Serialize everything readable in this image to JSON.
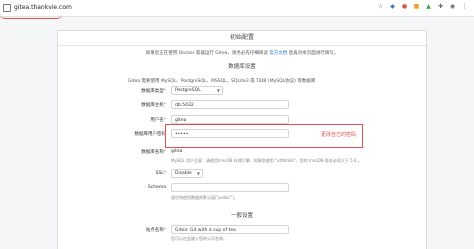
{
  "browser": {
    "url": "gitea.thankvie.com"
  },
  "page": {
    "title": "初始配置",
    "intro_text": "如果您正在使用 Docker 容器运行 Gitea，请务必先仔细阅读",
    "intro_link": "官方文档",
    "intro_suffix": "后再对本页面进行填写。",
    "db_section_title": "数据库设置",
    "db_note": "Gitea 需要使用 MySQL、PostgreSQL、MSSQL、SQLite3 或 TiDB (MySQL协议) 等数据库",
    "general_section_title": "一般设置"
  },
  "form": {
    "db_type_label": "数据库类型",
    "db_type_value": "PostgreSQL",
    "host_label": "数据库主机",
    "host_value": "db:5432",
    "user_label": "用户名",
    "user_value": "gitea",
    "password_label": "数据库用户密码",
    "password_value": "•••••",
    "db_name_label": "数据库名称",
    "db_name_value": "gitea",
    "db_name_help": "MySQL 用户注意：请使用InnoDB 存储引擎，如果您使用 \"utf8mb4\"，您的 InnoDB 版本必须大于 5.6 。",
    "ssl_label": "SSL",
    "ssl_value": "Disable",
    "schema_label": "Schema",
    "schema_value": "",
    "schema_help": "留空则使用数据库默认值(\"public\")。",
    "site_title_label": "站点名称",
    "site_title_value": "Gitea: Git with a cup of tea",
    "site_title_help": "您可以在此输入您的公司名称。"
  },
  "annotation": {
    "text": "更改自己的密码"
  },
  "colors": {
    "highlight": "#d9534f",
    "link": "#2b7cd3"
  }
}
